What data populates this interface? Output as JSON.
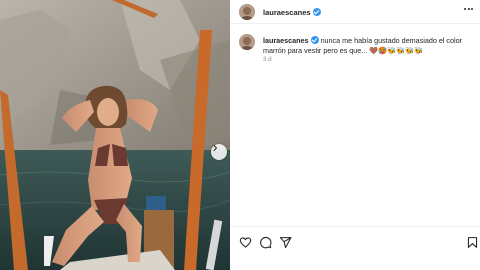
{
  "post": {
    "username": "lauraescanes",
    "verified": true,
    "caption_text": "nunca me había gustado demasiado el color marrón para vestir pero es que... 🤎🥵🐝🐝🐝🐝",
    "time_ago": "3 d"
  },
  "icons": {
    "header_more": "more-options-icon",
    "next": "chevron-right-icon",
    "like": "heart-icon",
    "comment": "comment-icon",
    "share": "send-icon",
    "save": "bookmark-icon"
  },
  "colors": {
    "verified": "#3897f0",
    "text": "#262626",
    "muted": "#8e8e8e",
    "divider": "#efefef"
  }
}
